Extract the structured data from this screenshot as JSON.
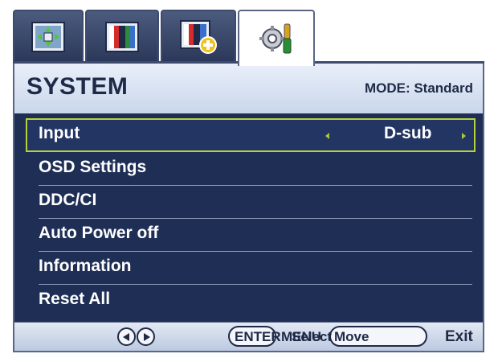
{
  "tabs": [
    {
      "icon": "picture-adjust-icon"
    },
    {
      "icon": "color-bars-icon"
    },
    {
      "icon": "color-bars-plus-icon"
    },
    {
      "icon": "system-settings-icon"
    }
  ],
  "header": {
    "title": "SYSTEM",
    "mode": "MODE: Standard"
  },
  "menu": {
    "items": [
      {
        "label": "Input",
        "value": "D-sub"
      },
      {
        "label": "OSD Settings"
      },
      {
        "label": "DDC/CI"
      },
      {
        "label": "Auto Power off"
      },
      {
        "label": "Information"
      },
      {
        "label": "Reset All"
      }
    ]
  },
  "footer": {
    "enter_text": "ENTER",
    "overlap_text": "MENU",
    "select_text": "Select",
    "move_text": "Move",
    "exit_text": "Exit"
  },
  "colors": {
    "panel": "#1e2e55",
    "highlight": "#b6d13a",
    "header": "#d6e0f0"
  }
}
